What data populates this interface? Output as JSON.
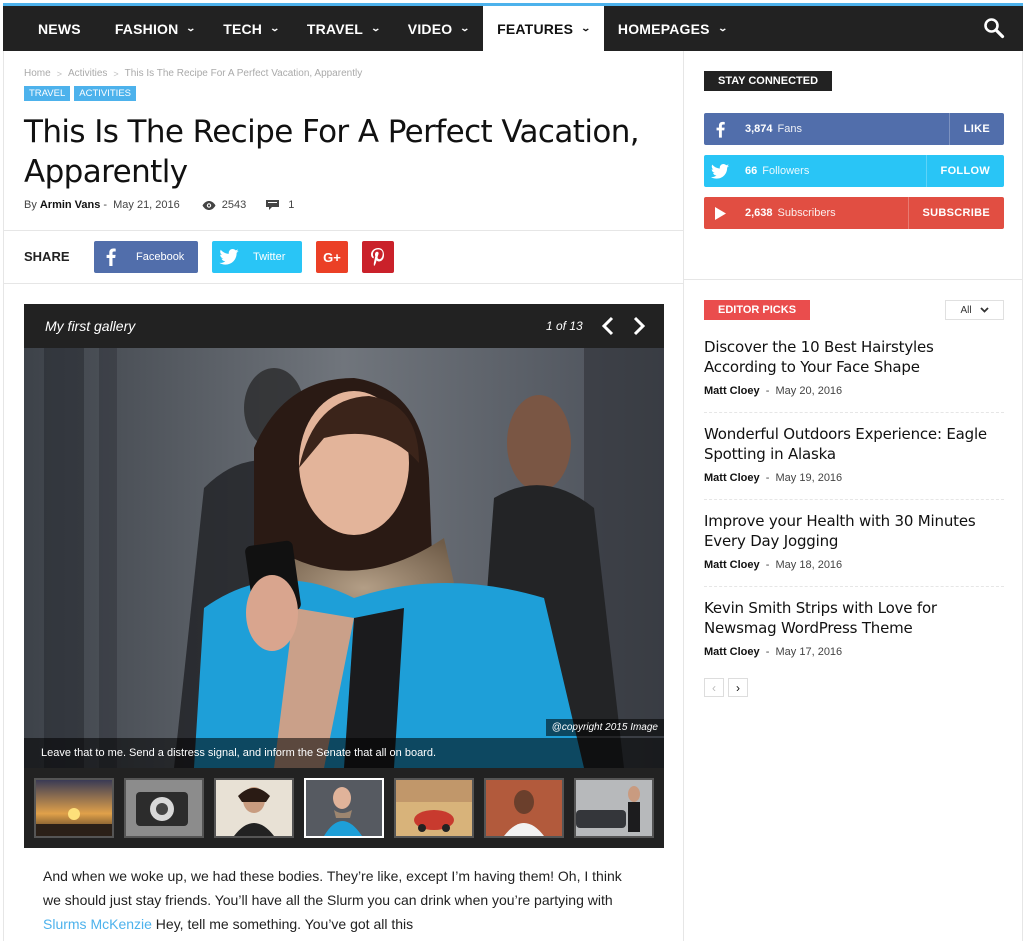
{
  "nav": {
    "items": [
      {
        "label": "NEWS",
        "dropdown": false
      },
      {
        "label": "FASHION",
        "dropdown": true
      },
      {
        "label": "TECH",
        "dropdown": true
      },
      {
        "label": "TRAVEL",
        "dropdown": true
      },
      {
        "label": "VIDEO",
        "dropdown": true
      },
      {
        "label": "FEATURES",
        "dropdown": true,
        "active": true
      },
      {
        "label": "HOMEPAGES",
        "dropdown": true
      }
    ],
    "search_icon": "search-icon"
  },
  "breadcrumb": {
    "home": "Home",
    "category": "Activities",
    "current": "This Is The Recipe For A Perfect Vacation, Apparently"
  },
  "article": {
    "categories": [
      "TRAVEL",
      "ACTIVITIES"
    ],
    "title": "This Is The Recipe For A Perfect Vacation, Apparently",
    "by": "By",
    "author": "Armin Vans",
    "date": "May 21, 2016",
    "views": "2543",
    "comments": "1"
  },
  "share": {
    "label": "SHARE",
    "facebook": "Facebook",
    "twitter": "Twitter"
  },
  "gallery": {
    "title": "My first gallery",
    "counter": "1 of 13",
    "copyright": "@copyright 2015 Image",
    "caption": "Leave that to me. Send a distress signal, and inform the Senate that all on board."
  },
  "body": {
    "text_1": "And when we woke up, we had these bodies. They’re like, except I’m having them! Oh, I think we should just stay friends. You’ll have all the Slurm you can drink when you’re partying with ",
    "link": "Slurms McKenzie",
    "text_2": " Hey, tell me something. You’ve got all this"
  },
  "sidebar": {
    "stay_connected": "STAY CONNECTED",
    "socials": [
      {
        "count": "3,874",
        "unit": "Fans",
        "action": "LIKE",
        "color": "#516eab"
      },
      {
        "count": "66",
        "unit": "Followers",
        "action": "FOLLOW",
        "color": "#29c5f6"
      },
      {
        "count": "2,638",
        "unit": "Subscribers",
        "action": "SUBSCRIBE",
        "color": "#e14e42"
      }
    ],
    "editor_picks": "EDITOR PICKS",
    "filter": "All",
    "picks": [
      {
        "title": "Discover the 10 Best Hairstyles According to Your Face Shape",
        "author": "Matt Cloey",
        "date": "May 20, 2016"
      },
      {
        "title": "Wonderful Outdoors Experience: Eagle Spotting in Alaska",
        "author": "Matt Cloey",
        "date": "May 19, 2016"
      },
      {
        "title": "Improve your Health with 30 Minutes Every Day Jogging",
        "author": "Matt Cloey",
        "date": "May 18, 2016"
      },
      {
        "title": "Kevin Smith Strips with Love for Newsmag WordPress Theme",
        "author": "Matt Cloey",
        "date": "May 17, 2016"
      }
    ]
  },
  "colors": {
    "accent": "#4db2ec",
    "nav_bg": "#222222",
    "editor_picks": "#ea4d4d"
  }
}
